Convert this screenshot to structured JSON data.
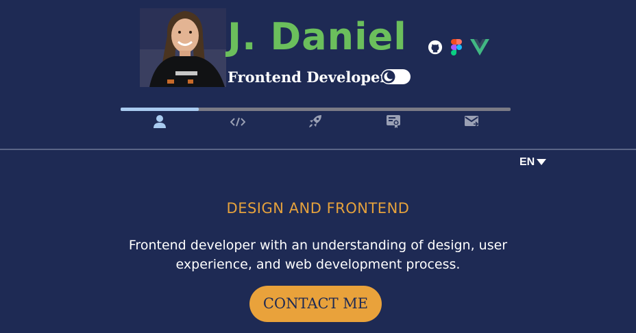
{
  "header": {
    "name": "J. Daniel",
    "role": "Frontend Developer",
    "tech_icons": [
      "github-icon",
      "figma-icon",
      "vue-icon"
    ],
    "theme_toggle_icon": "moon-icon",
    "avatar_alt": "profile-photo"
  },
  "navigation": {
    "progress": 0.2,
    "items": [
      "user-icon",
      "code-icon",
      "rocket-icon",
      "certificate-icon",
      "mail-icon"
    ],
    "active_index": 0
  },
  "language": {
    "selected": "EN"
  },
  "hero": {
    "heading": "DESIGN AND FRONTEND",
    "line1": "Frontend developer with an understanding of design, user",
    "line2": "experience, and web development process.",
    "cta_label": "CONTACT ME"
  },
  "colors": {
    "background": "#1e2a54",
    "brand_green": "#6bbf5c",
    "accent_orange": "#e9a23b",
    "progress_active": "#a9cbf0",
    "progress_track": "#7b7b86",
    "nav_icon_inactive": "#9aa0b4"
  }
}
